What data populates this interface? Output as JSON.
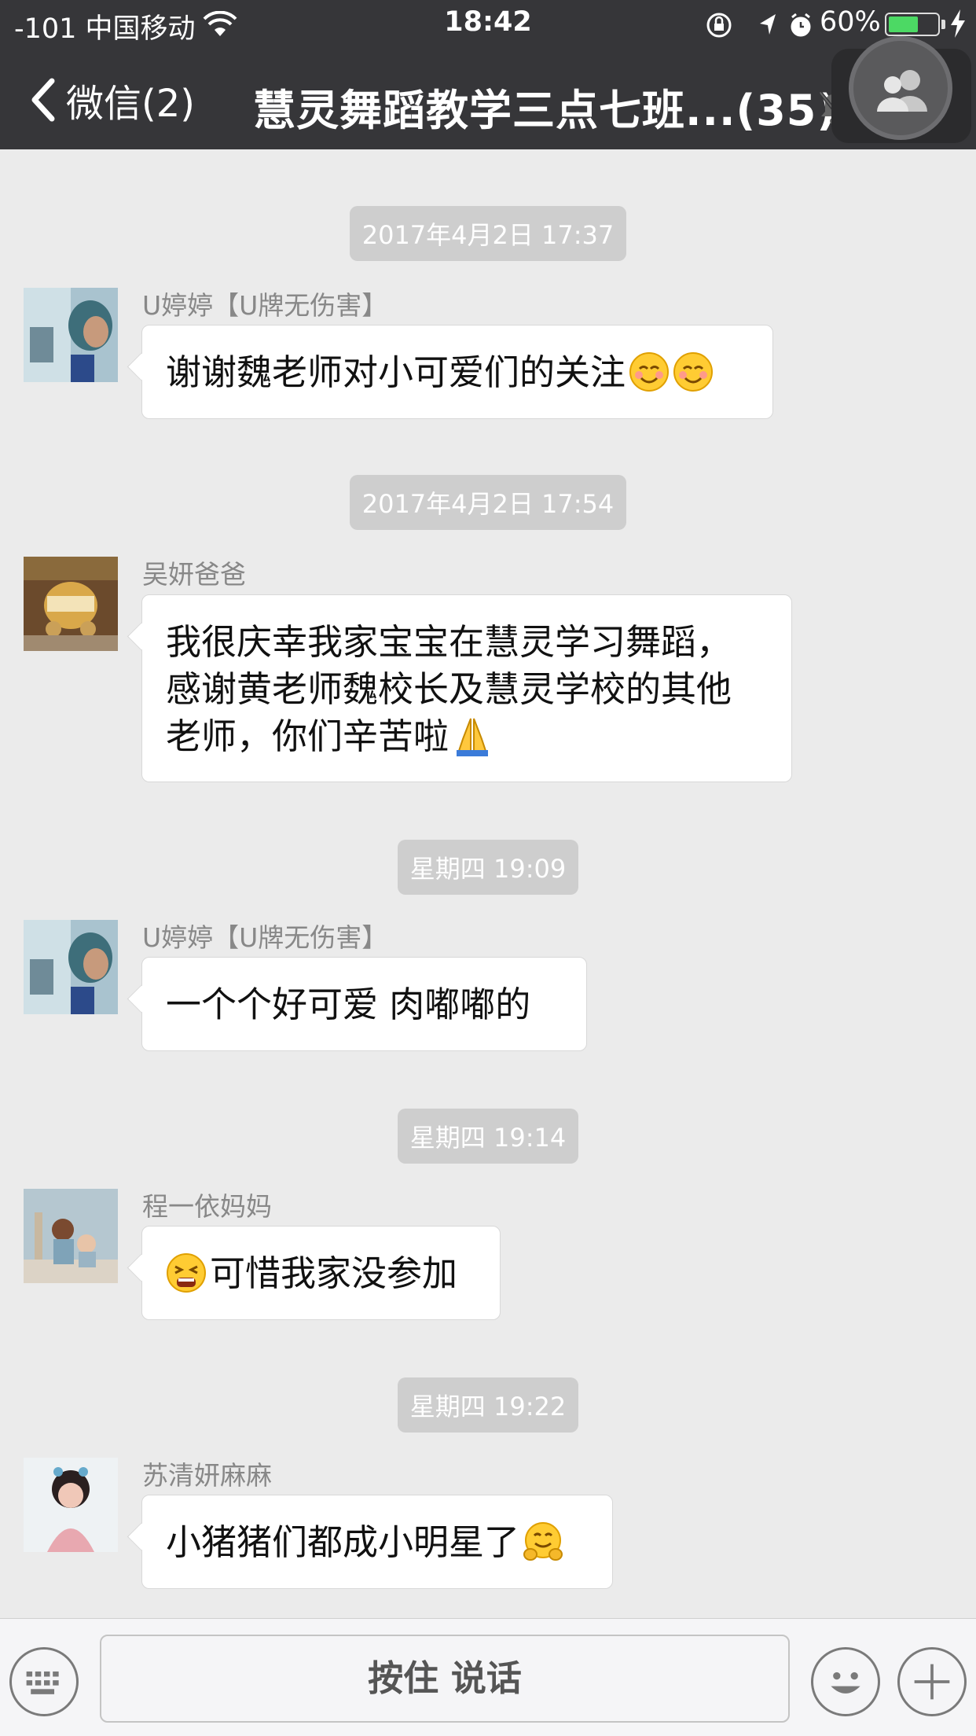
{
  "status_bar": {
    "carrier": "-101 中国移动",
    "time": "18:42",
    "battery_percent": "60%",
    "battery_level": 0.6
  },
  "nav": {
    "back_label": "微信(2)",
    "title": "慧灵舞蹈教学三点七班...(35)"
  },
  "messages": [
    {
      "timestamp": "2017年4月2日 17:37",
      "sender": "U婷婷【U牌无伤害】",
      "text": "谢谢魏老师对小可爱们的关注",
      "emojis": [
        "smiling-face-icon",
        "smiling-face-icon"
      ]
    },
    {
      "timestamp": "2017年4月2日 17:54",
      "sender": "吴妍爸爸",
      "text": "我很庆幸我家宝宝在慧灵学习舞蹈，\n感谢黄老师魏校长及慧灵学校的其他\n老师，你们辛苦啦",
      "emojis": [
        "folded-hands-icon"
      ]
    },
    {
      "timestamp": "星期四 19:09",
      "sender": "U婷婷【U牌无伤害】",
      "text": "一个个好可爱 肉嘟嘟的",
      "emojis": []
    },
    {
      "timestamp": "星期四 19:14",
      "sender": "程一依妈妈",
      "text": "可惜我家没参加",
      "emojis": [
        "tired-face-icon"
      ]
    },
    {
      "timestamp": "星期四 19:22",
      "sender": "苏清妍麻麻",
      "text": "小猪猪们都成小明星了",
      "emojis": [
        "hugging-face-icon"
      ]
    }
  ],
  "input_bar": {
    "hold_to_talk": "按住 说话"
  },
  "colors": {
    "nav_bg": "#363639",
    "chat_bg": "#ebebeb",
    "timestamp_bg": "#cecece",
    "battery_green": "#4cd964"
  }
}
